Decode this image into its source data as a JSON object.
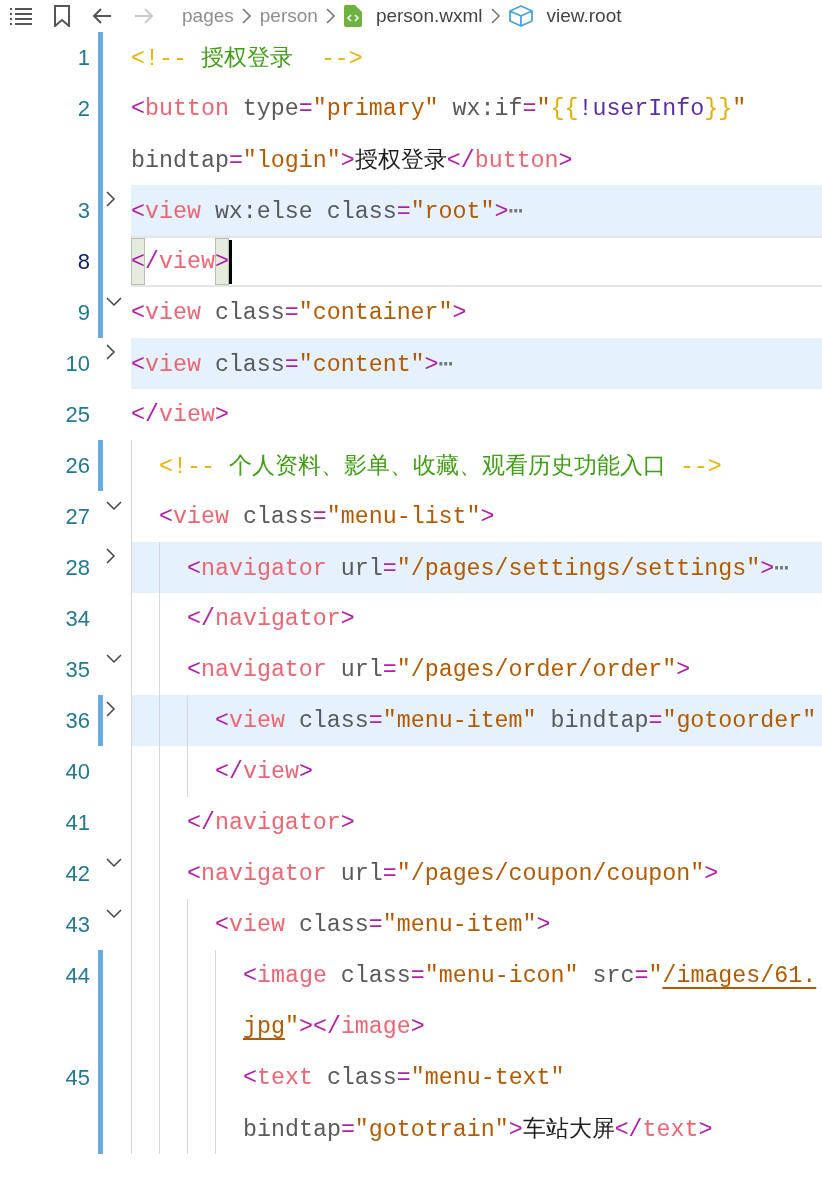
{
  "toolbar": {
    "buttons": [
      {
        "kind": "outline",
        "disabled": false
      },
      {
        "kind": "bookmark",
        "disabled": false
      },
      {
        "kind": "back",
        "disabled": false
      },
      {
        "kind": "forward",
        "disabled": true
      }
    ]
  },
  "breadcrumbs": [
    {
      "kind": "folder",
      "label": "pages"
    },
    {
      "kind": "folder",
      "label": "person"
    },
    {
      "kind": "file",
      "label": "person.wxml"
    },
    {
      "kind": "symbol",
      "label": "view.root"
    }
  ],
  "lines": [
    {
      "number": "1",
      "changed": true,
      "highlighted": false,
      "current": false,
      "cursor": false,
      "rows": [
        {
          "tokens": [
            {
              "kind": "cd",
              "text": "<!--"
            },
            {
              "kind": "cmt",
              "text": " 授权登录  "
            },
            {
              "kind": "cd",
              "text": "-->"
            }
          ]
        }
      ]
    },
    {
      "number": "2",
      "changed": true,
      "highlighted": false,
      "current": false,
      "cursor": false,
      "rows": [
        {
          "tokens": [
            {
              "kind": "b",
              "text": "<"
            },
            {
              "kind": "tag",
              "text": "button"
            },
            {
              "kind": "attr",
              "text": " type"
            },
            {
              "kind": "b",
              "text": "="
            },
            {
              "kind": "str",
              "text": "\"primary\""
            },
            {
              "kind": "attr",
              "text": " wx:if"
            },
            {
              "kind": "b",
              "text": "="
            },
            {
              "kind": "str",
              "text": "\""
            },
            {
              "kind": "tpl",
              "text": "{{"
            },
            {
              "kind": "var",
              "text": "!userInfo"
            },
            {
              "kind": "tpl",
              "text": "}}"
            },
            {
              "kind": "str",
              "text": "\""
            }
          ]
        },
        {
          "tokens": [
            {
              "kind": "attr",
              "text": "bindtap"
            },
            {
              "kind": "b",
              "text": "="
            },
            {
              "kind": "str",
              "text": "\"login\""
            },
            {
              "kind": "b",
              "text": ">"
            },
            {
              "kind": "txt",
              "text": "授权登录"
            },
            {
              "kind": "b",
              "text": "</"
            },
            {
              "kind": "tag",
              "text": "button"
            },
            {
              "kind": "b",
              "text": ">"
            }
          ]
        }
      ]
    },
    {
      "number": "3",
      "changed": true,
      "folded": true,
      "highlighted": true,
      "current": false,
      "cursor": false,
      "rows": [
        {
          "tokens": [
            {
              "kind": "b",
              "text": "<"
            },
            {
              "kind": "tag",
              "text": "view"
            },
            {
              "kind": "attr",
              "text": " wx:else class"
            },
            {
              "kind": "b",
              "text": "="
            },
            {
              "kind": "str",
              "text": "\"root\""
            },
            {
              "kind": "b",
              "text": ">"
            },
            {
              "kind": "ell",
              "text": "⋯"
            }
          ]
        }
      ]
    },
    {
      "number": "8",
      "changed": true,
      "highlighted": false,
      "current": true,
      "cursor": true,
      "rows": [
        {
          "tokens": [
            {
              "kind": "b",
              "text": "<",
              "matched": true
            },
            {
              "kind": "b",
              "text": "/"
            },
            {
              "kind": "tag",
              "text": "view"
            },
            {
              "kind": "b",
              "text": ">",
              "matched": true
            }
          ]
        }
      ]
    },
    {
      "number": "9",
      "changed": true,
      "folded": false,
      "highlighted": false,
      "current": false,
      "cursor": false,
      "rows": [
        {
          "tokens": [
            {
              "kind": "b",
              "text": "<"
            },
            {
              "kind": "tag",
              "text": "view"
            },
            {
              "kind": "attr",
              "text": " class"
            },
            {
              "kind": "b",
              "text": "="
            },
            {
              "kind": "str",
              "text": "\"container\""
            },
            {
              "kind": "b",
              "text": ">"
            }
          ]
        }
      ]
    },
    {
      "number": "10",
      "changed": false,
      "folded": true,
      "highlighted": true,
      "current": false,
      "cursor": false,
      "rows": [
        {
          "tokens": [
            {
              "kind": "b",
              "text": "<"
            },
            {
              "kind": "tag",
              "text": "view"
            },
            {
              "kind": "attr",
              "text": " class"
            },
            {
              "kind": "b",
              "text": "="
            },
            {
              "kind": "str",
              "text": "\"content\""
            },
            {
              "kind": "b",
              "text": ">"
            },
            {
              "kind": "ell",
              "text": "⋯"
            }
          ]
        }
      ]
    },
    {
      "number": "25",
      "changed": false,
      "highlighted": false,
      "current": false,
      "cursor": false,
      "rows": [
        {
          "tokens": [
            {
              "kind": "b",
              "text": "</"
            },
            {
              "kind": "tag",
              "text": "view"
            },
            {
              "kind": "b",
              "text": ">"
            }
          ]
        }
      ]
    },
    {
      "children": [
        {
          "number": "26",
          "changed": true,
          "highlighted": false,
          "current": false,
          "cursor": false,
          "rows": [
            {
              "tokens": [
                {
                  "kind": "cd",
                  "text": "<!--"
                },
                {
                  "kind": "cmt",
                  "text": " 个人资料、影单、收藏、观看历史功能入口 "
                },
                {
                  "kind": "cd",
                  "text": "-->"
                }
              ]
            }
          ]
        },
        {
          "number": "27",
          "changed": false,
          "folded": false,
          "highlighted": false,
          "current": false,
          "cursor": false,
          "rows": [
            {
              "tokens": [
                {
                  "kind": "b",
                  "text": "<"
                },
                {
                  "kind": "tag",
                  "text": "view"
                },
                {
                  "kind": "attr",
                  "text": " class"
                },
                {
                  "kind": "b",
                  "text": "="
                },
                {
                  "kind": "str",
                  "text": "\"menu-list\""
                },
                {
                  "kind": "b",
                  "text": ">"
                }
              ]
            }
          ],
          "children": [
            {
              "number": "28",
              "changed": false,
              "folded": true,
              "highlighted": true,
              "current": false,
              "cursor": false,
              "rows": [
                {
                  "tokens": [
                    {
                      "kind": "b",
                      "text": "<"
                    },
                    {
                      "kind": "tag",
                      "text": "navigator"
                    },
                    {
                      "kind": "attr",
                      "text": " url"
                    },
                    {
                      "kind": "b",
                      "text": "="
                    },
                    {
                      "kind": "str",
                      "text": "\"/pages/settings/settings\""
                    },
                    {
                      "kind": "b",
                      "text": ">"
                    },
                    {
                      "kind": "ell",
                      "text": "⋯"
                    }
                  ]
                }
              ]
            },
            {
              "number": "34",
              "changed": false,
              "highlighted": false,
              "current": false,
              "cursor": false,
              "rows": [
                {
                  "tokens": [
                    {
                      "kind": "b",
                      "text": "</"
                    },
                    {
                      "kind": "tag",
                      "text": "navigator"
                    },
                    {
                      "kind": "b",
                      "text": ">"
                    }
                  ]
                }
              ]
            },
            {
              "number": "35",
              "changed": false,
              "folded": false,
              "highlighted": false,
              "current": false,
              "cursor": false,
              "rows": [
                {
                  "tokens": [
                    {
                      "kind": "b",
                      "text": "<"
                    },
                    {
                      "kind": "tag",
                      "text": "navigator"
                    },
                    {
                      "kind": "attr",
                      "text": " url"
                    },
                    {
                      "kind": "b",
                      "text": "="
                    },
                    {
                      "kind": "str",
                      "text": "\"/pages/order/order\""
                    },
                    {
                      "kind": "b",
                      "text": ">"
                    }
                  ]
                }
              ],
              "children": [
                {
                  "number": "36",
                  "changed": true,
                  "folded": true,
                  "highlighted": true,
                  "current": false,
                  "cursor": false,
                  "rows": [
                    {
                      "tokens": [
                        {
                          "kind": "b",
                          "text": "<"
                        },
                        {
                          "kind": "tag",
                          "text": "view"
                        },
                        {
                          "kind": "attr",
                          "text": " class"
                        },
                        {
                          "kind": "b",
                          "text": "="
                        },
                        {
                          "kind": "str",
                          "text": "\"menu-item\""
                        },
                        {
                          "kind": "attr",
                          "text": " bindtap"
                        },
                        {
                          "kind": "b",
                          "text": "="
                        },
                        {
                          "kind": "str",
                          "text": "\"gotoorder\""
                        }
                      ]
                    }
                  ]
                },
                {
                  "number": "40",
                  "changed": false,
                  "highlighted": false,
                  "current": false,
                  "cursor": false,
                  "rows": [
                    {
                      "tokens": [
                        {
                          "kind": "b",
                          "text": "</"
                        },
                        {
                          "kind": "tag",
                          "text": "view"
                        },
                        {
                          "kind": "b",
                          "text": ">"
                        }
                      ]
                    }
                  ]
                }
              ]
            },
            {
              "number": "41",
              "changed": false,
              "highlighted": false,
              "current": false,
              "cursor": false,
              "rows": [
                {
                  "tokens": [
                    {
                      "kind": "b",
                      "text": "</"
                    },
                    {
                      "kind": "tag",
                      "text": "navigator"
                    },
                    {
                      "kind": "b",
                      "text": ">"
                    }
                  ]
                }
              ]
            },
            {
              "number": "42",
              "changed": false,
              "folded": false,
              "highlighted": false,
              "current": false,
              "cursor": false,
              "rows": [
                {
                  "tokens": [
                    {
                      "kind": "b",
                      "text": "<"
                    },
                    {
                      "kind": "tag",
                      "text": "navigator"
                    },
                    {
                      "kind": "attr",
                      "text": " url"
                    },
                    {
                      "kind": "b",
                      "text": "="
                    },
                    {
                      "kind": "str",
                      "text": "\"/pages/coupon/coupon\""
                    },
                    {
                      "kind": "b",
                      "text": ">"
                    }
                  ]
                }
              ],
              "children": [
                {
                  "number": "43",
                  "changed": false,
                  "folded": false,
                  "highlighted": false,
                  "current": false,
                  "cursor": false,
                  "rows": [
                    {
                      "tokens": [
                        {
                          "kind": "b",
                          "text": "<"
                        },
                        {
                          "kind": "tag",
                          "text": "view"
                        },
                        {
                          "kind": "attr",
                          "text": " class"
                        },
                        {
                          "kind": "b",
                          "text": "="
                        },
                        {
                          "kind": "str",
                          "text": "\"menu-item\""
                        },
                        {
                          "kind": "b",
                          "text": ">"
                        }
                      ]
                    }
                  ],
                  "children": [
                    {
                      "number": "44",
                      "changed": true,
                      "highlighted": false,
                      "current": false,
                      "cursor": false,
                      "rows": [
                        {
                          "tokens": [
                            {
                              "kind": "b",
                              "text": "<"
                            },
                            {
                              "kind": "tag",
                              "text": "image"
                            },
                            {
                              "kind": "attr",
                              "text": " class"
                            },
                            {
                              "kind": "b",
                              "text": "="
                            },
                            {
                              "kind": "str",
                              "text": "\"menu-icon\""
                            },
                            {
                              "kind": "attr",
                              "text": " src"
                            },
                            {
                              "kind": "b",
                              "text": "="
                            },
                            {
                              "kind": "str",
                              "text": "\""
                            },
                            {
                              "kind": "link",
                              "text": "/images/61."
                            }
                          ]
                        },
                        {
                          "tokens": [
                            {
                              "kind": "link",
                              "text": "jpg"
                            },
                            {
                              "kind": "str",
                              "text": "\""
                            },
                            {
                              "kind": "b",
                              "text": "></"
                            },
                            {
                              "kind": "tag",
                              "text": "image"
                            },
                            {
                              "kind": "b",
                              "text": ">"
                            }
                          ]
                        }
                      ]
                    },
                    {
                      "number": "45",
                      "changed": true,
                      "highlighted": false,
                      "current": false,
                      "cursor": false,
                      "rows": [
                        {
                          "tokens": [
                            {
                              "kind": "b",
                              "text": "<"
                            },
                            {
                              "kind": "tag",
                              "text": "text"
                            },
                            {
                              "kind": "attr",
                              "text": " class"
                            },
                            {
                              "kind": "b",
                              "text": "="
                            },
                            {
                              "kind": "str",
                              "text": "\"menu-text\""
                            }
                          ]
                        },
                        {
                          "tokens": [
                            {
                              "kind": "attr",
                              "text": "bindtap"
                            },
                            {
                              "kind": "b",
                              "text": "="
                            },
                            {
                              "kind": "str",
                              "text": "\"gototrain\""
                            },
                            {
                              "kind": "b",
                              "text": ">"
                            },
                            {
                              "kind": "txt",
                              "text": "车站大屏"
                            },
                            {
                              "kind": "b",
                              "text": "</"
                            },
                            {
                              "kind": "tag",
                              "text": "text"
                            },
                            {
                              "kind": "b",
                              "text": ">"
                            }
                          ]
                        }
                      ]
                    }
                  ]
                }
              ]
            }
          ]
        }
      ]
    }
  ]
}
